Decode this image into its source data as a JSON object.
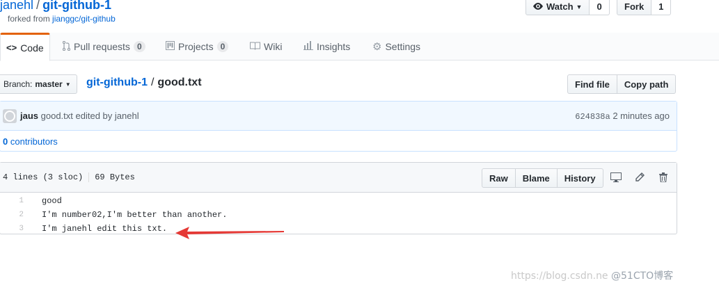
{
  "repo": {
    "owner": "janehl",
    "separator": "/",
    "name": "git-github-1",
    "forked_prefix": "forked from",
    "forked_source": "jianggc/git-github"
  },
  "header_buttons": {
    "watch_label": "Watch",
    "watch_count": "0",
    "fork_label": "Fork",
    "fork_count": "1"
  },
  "tabs": [
    {
      "label": "Code",
      "icon": "code-icon"
    },
    {
      "label": "Pull requests",
      "count": "0",
      "icon": "pull-request-icon"
    },
    {
      "label": "Projects",
      "count": "0",
      "icon": "project-icon"
    },
    {
      "label": "Wiki",
      "icon": "book-icon"
    },
    {
      "label": "Insights",
      "icon": "graph-icon"
    },
    {
      "label": "Settings",
      "icon": "gear-icon"
    }
  ],
  "breadcrumb": {
    "branch_prefix": "Branch:",
    "branch": "master",
    "repo_link": "git-github-1",
    "separator": "/",
    "file": "good.txt"
  },
  "file_buttons": {
    "find_file": "Find file",
    "copy_path": "Copy path"
  },
  "commit": {
    "author": "jaus",
    "message": "good.txt edited by janehl",
    "sha": "624838a",
    "time": "2 minutes ago",
    "contributors_count": "0",
    "contributors_label": "contributors"
  },
  "file": {
    "lines_info": "4 lines (3 sloc)",
    "size": "69 Bytes",
    "raw": "Raw",
    "blame": "Blame",
    "history": "History",
    "lines": [
      {
        "num": "1",
        "text": "good"
      },
      {
        "num": "2",
        "text": "I'm number02,I'm better than another."
      },
      {
        "num": "3",
        "text": "I'm janehl edit this txt."
      }
    ]
  },
  "watermark": {
    "url": "https://blog.csdn.ne",
    "brand": "@51CTO博客"
  }
}
